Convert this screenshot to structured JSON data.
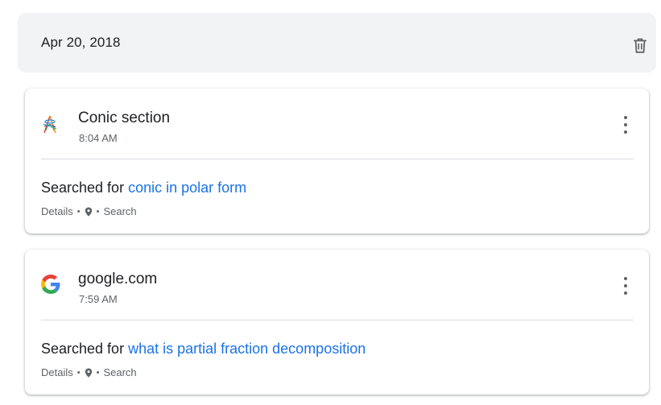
{
  "group": {
    "date": "Apr 20, 2018",
    "delete_icon": "trash-icon"
  },
  "entries": [
    {
      "site": "Conic section",
      "site_icon": "conic-section-favicon",
      "time": "8:04 AM",
      "action_prefix": "Searched for",
      "query": "conic in polar form",
      "details": "Details",
      "sep": "•",
      "location_icon": "location-pin-icon",
      "product": "Search"
    },
    {
      "site": "google.com",
      "site_icon": "google-g-icon",
      "time": "7:59 AM",
      "action_prefix": "Searched for",
      "query": "what is partial fraction decomposition",
      "details": "Details",
      "sep": "•",
      "location_icon": "location-pin-icon",
      "product": "Search"
    }
  ],
  "colors": {
    "link": "#1a73e8",
    "secondary_text": "#5f6368",
    "header_bg": "#f1f3f4"
  }
}
